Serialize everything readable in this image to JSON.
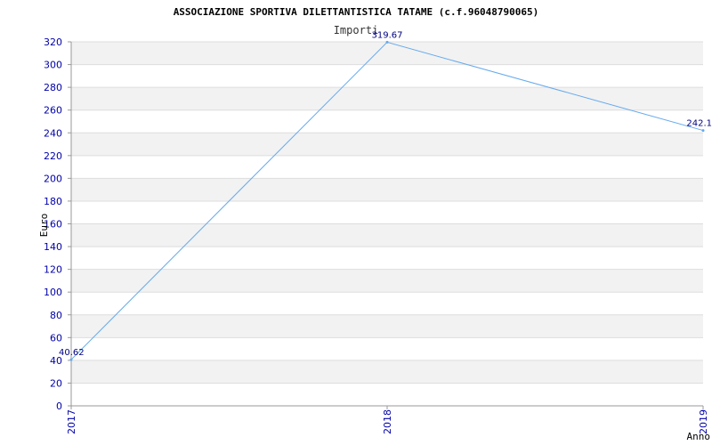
{
  "chart_data": {
    "type": "line",
    "title": "ASSOCIAZIONE SPORTIVA DILETTANTISTICA TATAME (c.f.96048790065)",
    "subtitle": "Importi",
    "xlabel": "Anno",
    "ylabel": "Euro",
    "categories": [
      "2017",
      "2018",
      "2019"
    ],
    "series": [
      {
        "values": [
          40.62,
          319.67,
          242.1
        ],
        "labels": [
          "40.62",
          "319.67",
          "242.1"
        ]
      }
    ],
    "ylim": [
      0,
      320
    ],
    "yticks": [
      0,
      20,
      40,
      60,
      80,
      100,
      120,
      140,
      160,
      180,
      200,
      220,
      240,
      260,
      280,
      300,
      320
    ],
    "grid": true,
    "colors": {
      "line": "#66aaee",
      "band": "#f2f2f2",
      "tick_text": "#0000aa",
      "data_label": "#000080"
    }
  }
}
